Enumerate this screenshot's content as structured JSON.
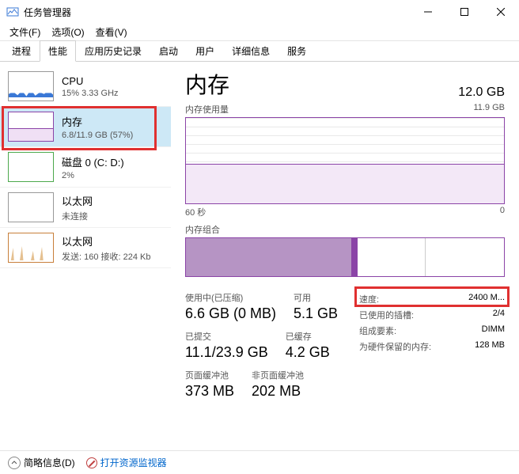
{
  "window": {
    "title": "任务管理器"
  },
  "menu": {
    "file": "文件(F)",
    "options": "选项(O)",
    "view": "查看(V)"
  },
  "tabs": [
    "进程",
    "性能",
    "应用历史记录",
    "启动",
    "用户",
    "详细信息",
    "服务"
  ],
  "active_tab": 1,
  "sidebar": {
    "items": [
      {
        "title": "CPU",
        "sub": "15% 3.33 GHz"
      },
      {
        "title": "内存",
        "sub": "6.8/11.9 GB (57%)"
      },
      {
        "title": "磁盘 0 (C: D:)",
        "sub": "2%"
      },
      {
        "title": "以太网",
        "sub": "未连接"
      },
      {
        "title": "以太网",
        "sub": "发送: 160 接收: 224 Kb"
      }
    ],
    "selected": 1
  },
  "main": {
    "title": "内存",
    "capacity": "12.0 GB",
    "usage_graph_label": "内存使用量",
    "usage_graph_max": "11.9 GB",
    "graph_time_left": "60 秒",
    "graph_time_right": "0",
    "composition_label": "内存组合",
    "stats": {
      "in_use_label": "使用中(已压缩)",
      "in_use_value": "6.6 GB (0 MB)",
      "available_label": "可用",
      "available_value": "5.1 GB",
      "committed_label": "已提交",
      "committed_value": "11.1/23.9 GB",
      "cached_label": "已缓存",
      "cached_value": "4.2 GB",
      "paged_label": "页面缓冲池",
      "paged_value": "373 MB",
      "nonpaged_label": "非页面缓冲池",
      "nonpaged_value": "202 MB"
    },
    "info": {
      "speed_label": "速度:",
      "speed_value": "2400 M...",
      "slots_label": "已使用的插槽:",
      "slots_value": "2/4",
      "form_label": "组成要素:",
      "form_value": "DIMM",
      "reserved_label": "为硬件保留的内存:",
      "reserved_value": "128 MB"
    }
  },
  "footer": {
    "fewer_details": "简略信息(D)",
    "resource_monitor": "打开资源监视器"
  }
}
